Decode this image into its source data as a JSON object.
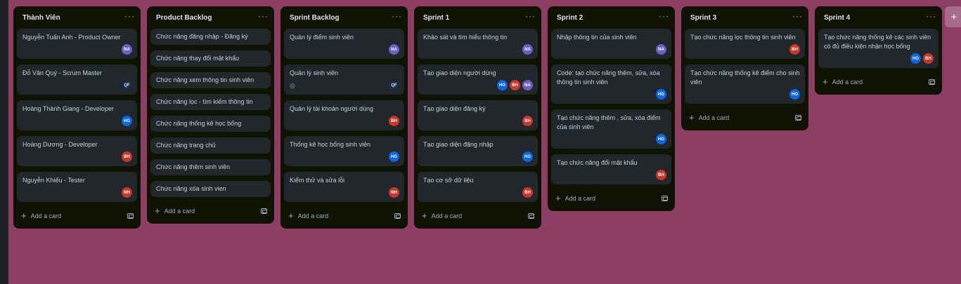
{
  "board": {
    "add_list_icon": "plus-icon",
    "add_list_symbol": "+",
    "lists": [
      {
        "title": "Thành Viên",
        "menu": "···",
        "add_card": "Add a card",
        "cards": [
          {
            "title": "Nguyễn Tuấn Anh - Product Owner",
            "avatars": [
              "NA"
            ]
          },
          {
            "title": "Đỗ Văn Quý - Scrum Master",
            "avatars": [
              "QF"
            ]
          },
          {
            "title": "Hoàng Thành Giang - Developer",
            "avatars": [
              "HG"
            ]
          },
          {
            "title": "Hoàng Dương - Developer",
            "avatars": [
              "BH"
            ]
          },
          {
            "title": "Nguyễn Khiếu - Tester",
            "avatars": [
              "NH"
            ]
          }
        ]
      },
      {
        "title": "Product Backlog",
        "menu": "···",
        "add_card": "Add a card",
        "cards": [
          {
            "title": "Chức năng đăng nhập - Đăng ký",
            "avatars": []
          },
          {
            "title": "Chức năng thay đổi mật khẩu",
            "avatars": []
          },
          {
            "title": "Chức năng xem thông tin sinh viên",
            "avatars": []
          },
          {
            "title": "Chức năng lọc - tìm kiếm thông tin",
            "avatars": []
          },
          {
            "title": "Chức năng thống kê học bổng",
            "avatars": []
          },
          {
            "title": "Chức năng trang chủ",
            "avatars": []
          },
          {
            "title": "Chức năng thêm sinh viên",
            "avatars": []
          },
          {
            "title": "Chức năng xóa sinh vien",
            "avatars": []
          }
        ]
      },
      {
        "title": "Sprint Backlog",
        "menu": "···",
        "add_card": "Add a card",
        "cards": [
          {
            "title": "Quản lý điểm sinh viên",
            "avatars": [
              "NA"
            ]
          },
          {
            "title": "Quản lý sinh viên",
            "avatars": [
              "QF"
            ],
            "watch": true
          },
          {
            "title": "Quản lý tài khoản người dùng",
            "avatars": [
              "BH"
            ]
          },
          {
            "title": "Thống kê học bổng sinh viên",
            "avatars": [
              "HG"
            ]
          },
          {
            "title": "Kiểm thử và sửa lỗi",
            "avatars": [
              "NH"
            ]
          }
        ]
      },
      {
        "title": "Sprint 1",
        "menu": "···",
        "add_card": "Add a card",
        "cards": [
          {
            "title": "Khảo sát và tìm hiểu thông tin",
            "avatars": [
              "NA"
            ]
          },
          {
            "title": "Tạo giao diện người dùng",
            "avatars": [
              "HG",
              "BH",
              "NA"
            ]
          },
          {
            "title": "Tạo giao diện đăng ký",
            "avatars": [
              "BH"
            ]
          },
          {
            "title": "Tạo giao diện đăng nhập",
            "avatars": [
              "HG"
            ]
          },
          {
            "title": "Tạo cơ sở dữ liệu",
            "avatars": [
              "BH"
            ]
          }
        ]
      },
      {
        "title": "Sprint 2",
        "menu": "···",
        "add_card": "Add a card",
        "cards": [
          {
            "title": "Nhập thông tin của sinh viên",
            "avatars": [
              "NA"
            ]
          },
          {
            "title": "Code: tạo chức năng thêm, sửa, xóa thông tin sinh viên",
            "avatars": [
              "HG"
            ]
          },
          {
            "title": "Tạo chức năng thêm , sửa, xóa điểm của sinh viên",
            "avatars": [
              "HG"
            ]
          },
          {
            "title": "Tạo chức năng đổi mật khẩu",
            "avatars": [
              "BH"
            ]
          }
        ]
      },
      {
        "title": "Sprint 3",
        "menu": "···",
        "add_card": "Add a card",
        "cards": [
          {
            "title": "Tạo chức năng lọc thông tin sinh viên",
            "avatars": [
              "BH"
            ]
          },
          {
            "title": "Tạo chức năng thống kê điểm cho sinh viên",
            "avatars": [
              "HG"
            ]
          }
        ]
      },
      {
        "title": "Sprint 4",
        "menu": "···",
        "add_card": "Add a card",
        "cards": [
          {
            "title": "Tạo chức năng thống kê các sinh viên có đủ điều kiện nhận học bổng",
            "avatars": [
              "HG",
              "BH"
            ]
          }
        ]
      }
    ]
  },
  "colors": {
    "background": "#8c3e63",
    "list_bg": "#101204",
    "card_bg": "#22272b"
  }
}
